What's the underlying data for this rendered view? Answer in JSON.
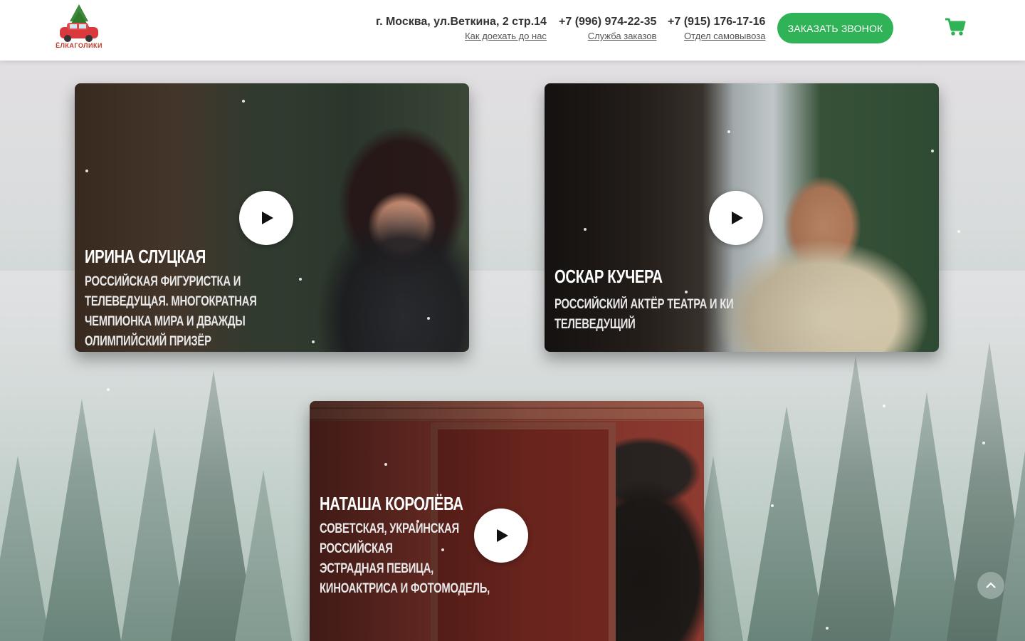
{
  "header": {
    "logo_text": "ЁЛКАГОЛИКИ",
    "address": {
      "main": "г. Москва, ул.Веткина, 2 стр.14",
      "sub": "Как доехать до нас"
    },
    "phone1": {
      "main": "+7 (996) 974-22-35",
      "sub": "Служба заказов"
    },
    "phone2": {
      "main": "+7 (915) 176-17-16",
      "sub": "Отдел самовывоза"
    },
    "callback_label": "ЗАКАЗАТЬ ЗВОНОК",
    "cart_icon": "cart-icon"
  },
  "videos": [
    {
      "name": "Ирина Слуцкая",
      "description": "Российская фигуристка и\nтелеведущая. Многократная\nчемпионка мира и дважды\nолимпийский призёр"
    },
    {
      "name": "Оскар Кучера",
      "description": "Российский актёр театра и ки\nтелеведущий"
    },
    {
      "name": "Наташа Королёва",
      "description": "Советская, украинская\nроссийская\nэстрадная певица,\nкиноактриса и фотомодель,"
    }
  ],
  "colors": {
    "accent": "#2fb356",
    "header_bg": "#ffffff",
    "text": "#333333"
  },
  "icons": [
    "cart-icon",
    "play-icon",
    "chevron-up-icon",
    "logo-icon"
  ]
}
